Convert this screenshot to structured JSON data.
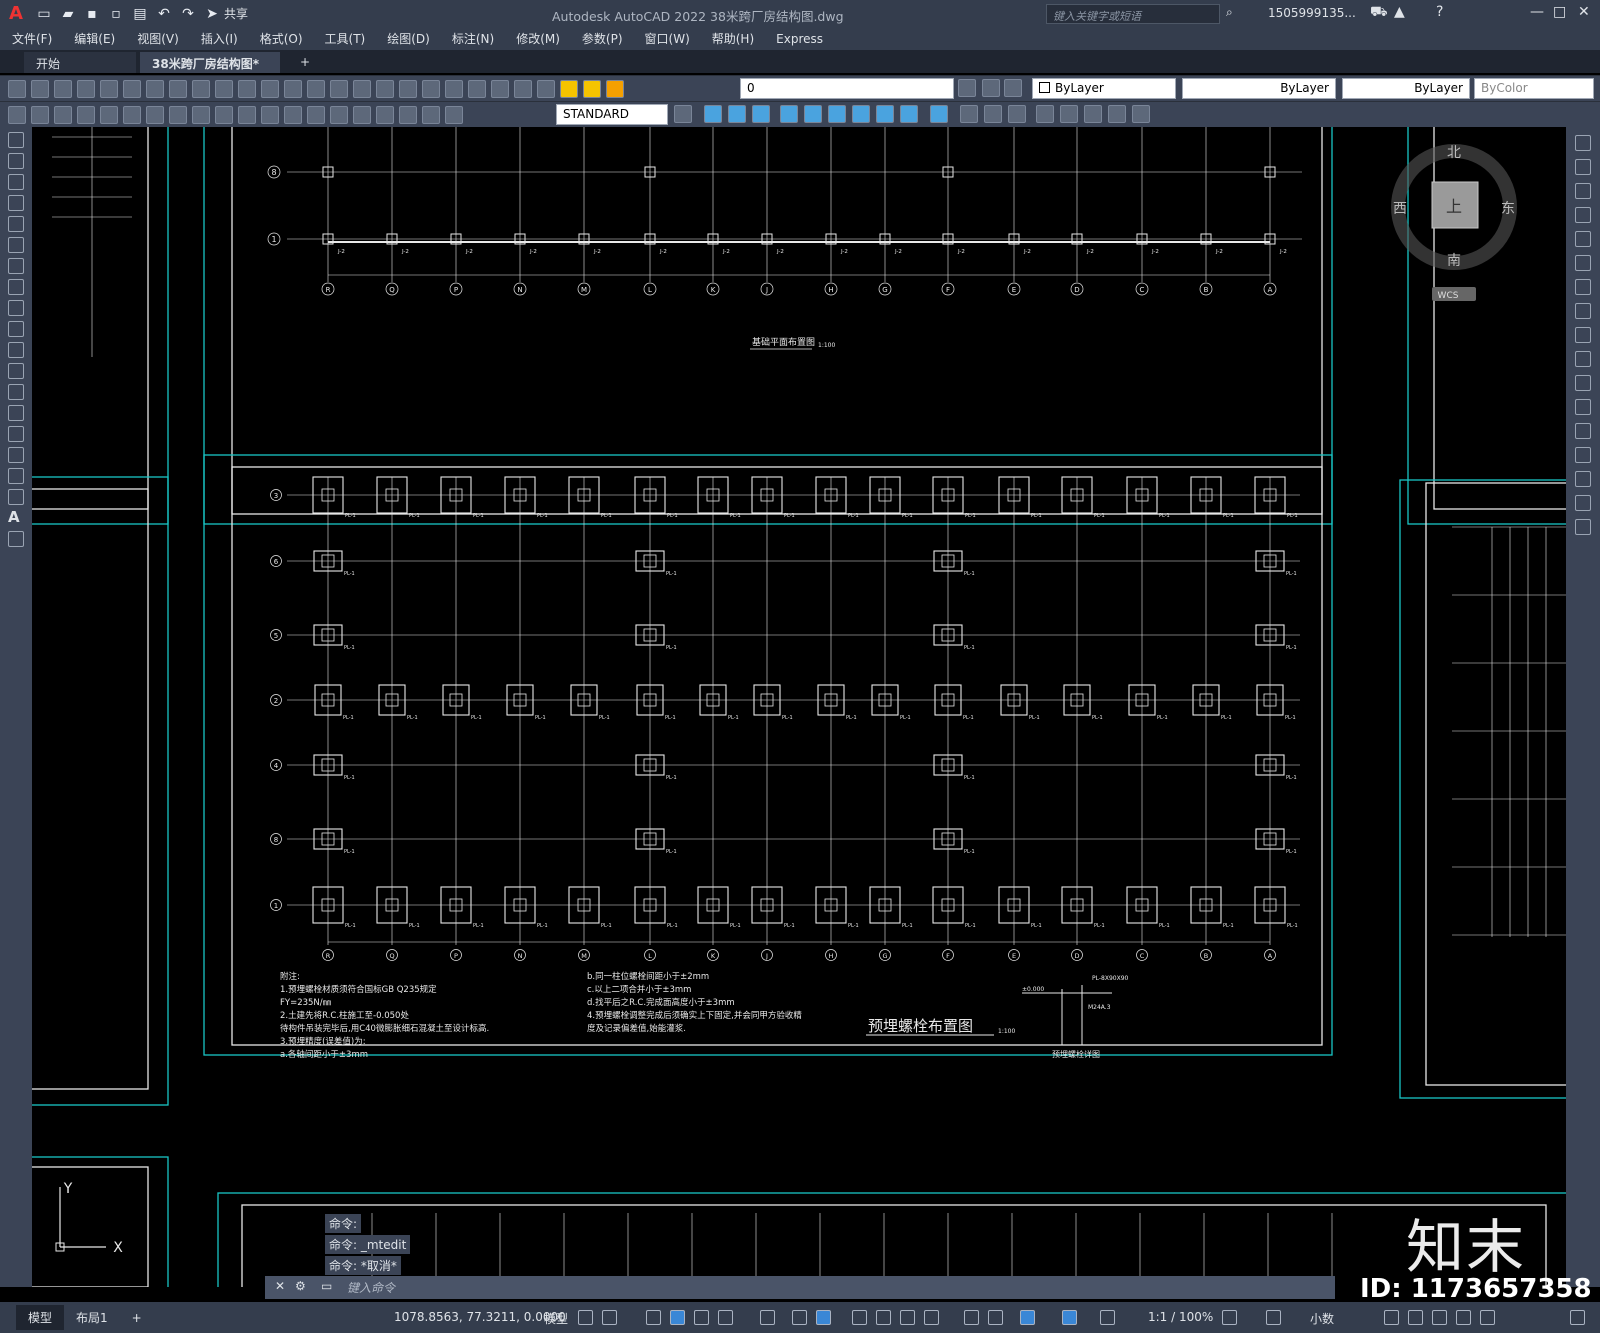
{
  "app": {
    "logo": "A",
    "title": "Autodesk AutoCAD 2022    38米跨厂房结构图.dwg",
    "share_label": "共享",
    "search_placeholder": "键入关键字或短语",
    "user": "1505999135..."
  },
  "menu": [
    "文件(F)",
    "编辑(E)",
    "视图(V)",
    "插入(I)",
    "格式(O)",
    "工具(T)",
    "绘图(D)",
    "标注(N)",
    "修改(M)",
    "参数(P)",
    "窗口(W)",
    "帮助(H)",
    "Express"
  ],
  "tabs": {
    "start": "开始",
    "drawing": "38米跨厂房结构图*",
    "add": "+"
  },
  "toolbar": {
    "layer_value": "0",
    "text_style": "STANDARD",
    "color": "ByLayer",
    "linetype": "ByLayer",
    "lineweight": "ByLayer",
    "plotstyle": "ByColor"
  },
  "viewcube": {
    "north": "北",
    "south": "南",
    "east": "东",
    "west": "西",
    "top": "上",
    "wcs": "WCS"
  },
  "drawing": {
    "foundation_title": "基础平面布置图",
    "foundation_scale": "1:100",
    "bolt_title": "预埋螺栓布置图",
    "bolt_scale": "1:100",
    "detail_title": "预埋螺栓详图",
    "detail_plate": "PL-8X90X90",
    "detail_bolt": "M24A.3",
    "detail_elev": "±0.000",
    "notes_col1": [
      "附注:",
      "1.预埋螺栓材质须符合国标GB Q235规定",
      "   FY=235N/㎜",
      "2.土建先将R.C.柱施工至-0.050处",
      "   待构件吊装完毕后,用C40微膨胀细石混凝土至设计标高.",
      "3.预埋精度(误差值)为:",
      "   a.各轴间距小于±3mm"
    ],
    "notes_col2": [
      "b.同一柱位螺栓间距小于±2mm",
      "c.以上二项合并小于±3mm",
      "d.找平后之R.C.完成面高度小于±3mm",
      "4.预埋螺栓调整完成后须确实上下固定,并会同甲方验收精",
      "  度及记录偏差值,始能灌浆."
    ],
    "col_axes": [
      "R",
      "Q",
      "P",
      "N",
      "M",
      "L",
      "K",
      "J",
      "H",
      "G",
      "F",
      "E",
      "D",
      "C",
      "B",
      "A"
    ],
    "row_axes_bolt": [
      "3",
      "6",
      "5",
      "2",
      "4",
      "8",
      "1"
    ],
    "row_axes_found": [
      "8",
      "1"
    ],
    "bolt_label": "PL-1",
    "found_label": "J-2"
  },
  "ucs": {
    "x": "X",
    "y": "Y"
  },
  "command": {
    "history": [
      "命令:",
      "命令: _mtedit",
      "命令: *取消*"
    ],
    "input_placeholder": "键入命令"
  },
  "status": {
    "model_tab": "模型",
    "layout_tab": "布局1",
    "coords": "1078.8563, 77.3211, 0.0000",
    "space": "模型",
    "scale": "1:1 / 100%",
    "units": "小数"
  },
  "watermark": {
    "brand": "知末",
    "id": "ID: 1173657358"
  }
}
